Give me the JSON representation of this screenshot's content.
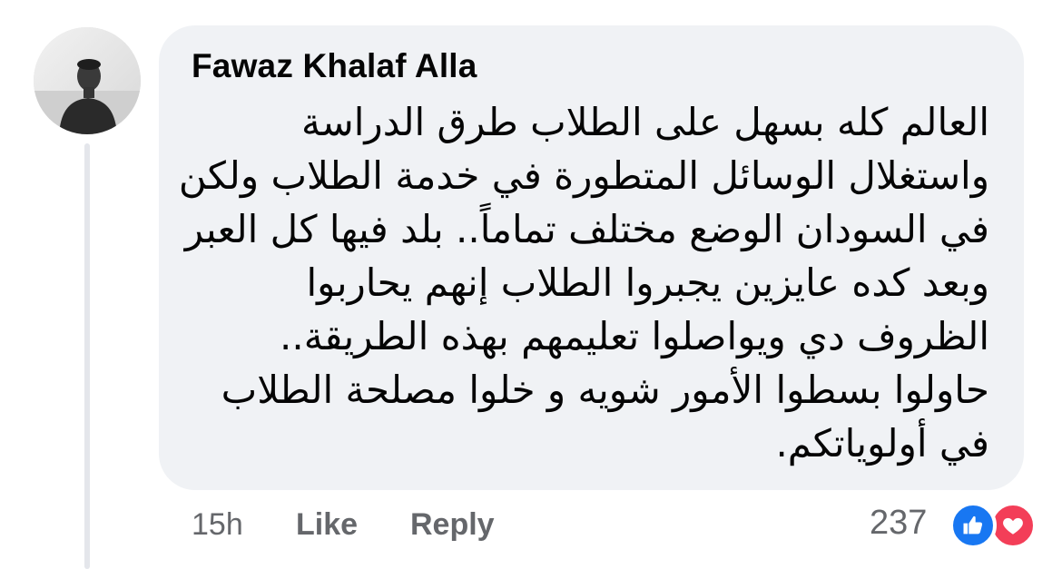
{
  "comment": {
    "author": "Fawaz Khalaf Alla",
    "text_lines": [
      "العالم كله بسهل على الطلاب طرق الدراسة",
      "واستغلال الوسائل المتطورة في خدمة الطلاب ولكن",
      "في السودان الوضع مختلف تماماً.. بلد فيها كل العبر",
      "وبعد كده عايزين يجبروا الطلاب إنهم يحاربوا",
      "الظروف دي ويواصلوا تعليمهم بهذه الطريقة..",
      "حاولوا بسطوا الأمور شويه و خلوا مصلحة الطلاب",
      "في أولوياتكم."
    ]
  },
  "actions": {
    "timestamp": "15h",
    "like_label": "Like",
    "reply_label": "Reply"
  },
  "reactions": {
    "count": "237",
    "icons": [
      "like-icon",
      "love-icon"
    ],
    "like_color": "#1877f2",
    "love_color": "#f33e58"
  },
  "colors": {
    "bubble": "#f0f2f5",
    "secondary_text": "#65676b",
    "primary_text": "#050505"
  }
}
